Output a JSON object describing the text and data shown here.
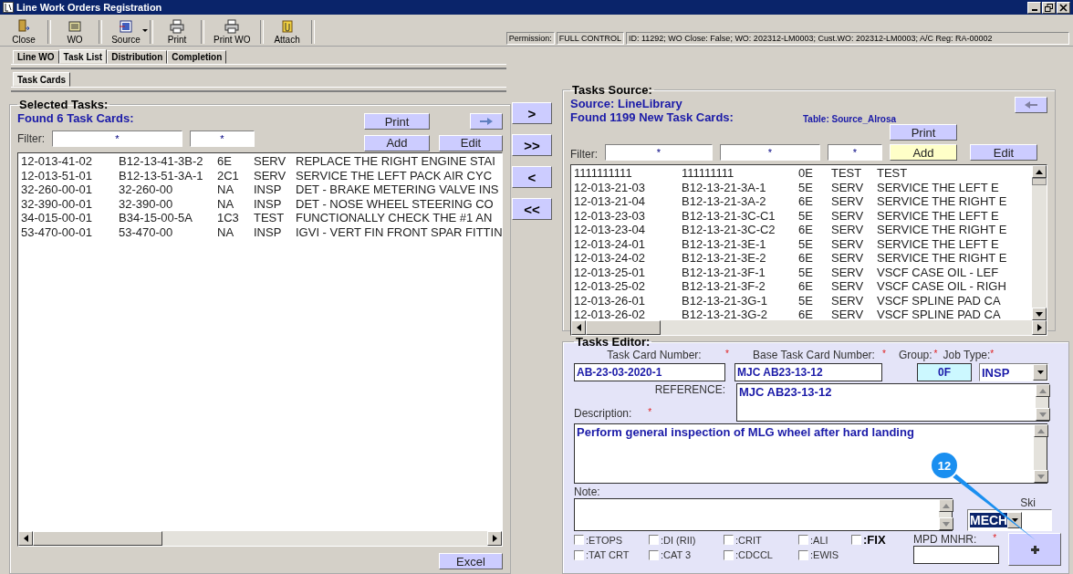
{
  "window": {
    "title": "Line Work Orders Registration"
  },
  "toolbar": [
    {
      "label": "Close",
      "kind": "door",
      "dropdown": false
    },
    {
      "label": "WO",
      "kind": "doc",
      "dropdown": false
    },
    {
      "label": "Source",
      "kind": "source",
      "dropdown": true
    },
    {
      "label": "Print",
      "kind": "printer",
      "dropdown": false
    },
    {
      "label": "Print WO",
      "kind": "printer",
      "dropdown": false
    },
    {
      "label": "Attach",
      "kind": "clip",
      "dropdown": false
    }
  ],
  "status": {
    "permission_label": "Permission:",
    "permission": "FULL CONTROL",
    "info": "ID: 11292; WO Close: False; WO: 202312-LM0003; Cust.WO: 202312-LM0003; A/C Reg: RA-00002"
  },
  "tabs": [
    {
      "label": "Line WO",
      "selected": false
    },
    {
      "label": "Task List",
      "selected": true
    },
    {
      "label": "Distribution",
      "selected": false
    },
    {
      "label": "Completion",
      "selected": false
    }
  ],
  "subtabs": [
    {
      "label": "Task Cards",
      "selected": true
    }
  ],
  "selected_tasks": {
    "title": "Selected Tasks:",
    "found": "Found 6 Task Cards:",
    "filter_label": "Filter:",
    "filters": [
      "*",
      "*"
    ],
    "buttons": [
      {
        "label": "Print",
        "highlighted": false
      },
      {
        "label": "Add",
        "highlighted": false
      },
      {
        "label": "Edit",
        "highlighted": false
      }
    ],
    "rows": [
      [
        "12-013-41-02",
        "B12-13-41-3B-2",
        "6E",
        "SERV",
        "REPLACE THE RIGHT ENGINE STAI"
      ],
      [
        "12-013-51-01",
        "B12-13-51-3A-1",
        "2C1",
        "SERV",
        "SERVICE THE LEFT PACK AIR CYC"
      ],
      [
        "32-260-00-01",
        "32-260-00",
        "NA",
        "INSP",
        "DET - BRAKE METERING VALVE INS"
      ],
      [
        "32-390-00-01",
        "32-390-00",
        "NA",
        "INSP",
        "DET - NOSE WHEEL STEERING CO"
      ],
      [
        "34-015-00-01",
        "B34-15-00-5A",
        "1C3",
        "TEST",
        "FUNCTIONALLY CHECK THE  #1 AN"
      ],
      [
        "53-470-00-01",
        "53-470-00",
        "NA",
        "INSP",
        "IGVI - VERT FIN FRONT SPAR FITTIN"
      ]
    ],
    "excel": "Excel"
  },
  "move_buttons": [
    ">",
    ">>",
    "<",
    "<<"
  ],
  "tasks_source": {
    "title": "Tasks Source:",
    "source": "Source: LineLibrary",
    "found": "Found 1199 New Task Cards:",
    "table": "Table: Source_Alrosa",
    "filter_label": "Filter:",
    "filters": [
      "*",
      "*",
      "*"
    ],
    "buttons": [
      {
        "label": "Print",
        "highlighted": false
      },
      {
        "label": "Add",
        "highlighted": true
      },
      {
        "label": "Edit",
        "highlighted": false
      }
    ],
    "rows": [
      [
        "1111111111",
        "111111111",
        "0E",
        "TEST",
        "TEST"
      ],
      [
        "12-013-21-03",
        "B12-13-21-3A-1",
        "5E",
        "SERV",
        "SERVICE THE LEFT E"
      ],
      [
        "12-013-21-04",
        "B12-13-21-3A-2",
        "6E",
        "SERV",
        "SERVICE THE RIGHT E"
      ],
      [
        "12-013-23-03",
        "B12-13-21-3C-C1",
        "5E",
        "SERV",
        "SERVICE THE LEFT E"
      ],
      [
        "12-013-23-04",
        "B12-13-21-3C-C2",
        "6E",
        "SERV",
        "SERVICE THE RIGHT E"
      ],
      [
        "12-013-24-01",
        "B12-13-21-3E-1",
        "5E",
        "SERV",
        "SERVICE THE LEFT E"
      ],
      [
        "12-013-24-02",
        "B12-13-21-3E-2",
        "6E",
        "SERV",
        "SERVICE THE RIGHT E"
      ],
      [
        "12-013-25-01",
        "B12-13-21-3F-1",
        "5E",
        "SERV",
        "VSCF CASE OIL - LEF"
      ],
      [
        "12-013-25-02",
        "B12-13-21-3F-2",
        "6E",
        "SERV",
        "VSCF CASE OIL - RIGH"
      ],
      [
        "12-013-26-01",
        "B12-13-21-3G-1",
        "5E",
        "SERV",
        "VSCF SPLINE PAD CA"
      ],
      [
        "12-013-26-02",
        "B12-13-21-3G-2",
        "6E",
        "SERV",
        "VSCF SPLINE PAD CA"
      ]
    ]
  },
  "editor": {
    "title": "Tasks Editor:",
    "task_card_number": {
      "label": "Task Card Number:",
      "mark": "*",
      "value": "AB-23-03-2020-1"
    },
    "base_task_card_number": {
      "label": "Base Task Card Number:",
      "mark": "*",
      "value": "MJC AB23-13-12"
    },
    "group": {
      "label": "Group:",
      "mark": "*",
      "value": "0F"
    },
    "job_type": {
      "label": "Job Type:",
      "mark": "*",
      "value": "INSP"
    },
    "reference": {
      "label": "REFERENCE:",
      "value": "MJC AB23-13-12"
    },
    "description": {
      "label": "Description:",
      "mark": "*",
      "value": "Perform general inspection of MLG wheel after hard landing"
    },
    "note": {
      "label": "Note:"
    },
    "skill": {
      "label": "Ski",
      "value": "MECH",
      "highlighted": true
    },
    "checkboxes": [
      {
        "label": ":ETOPS",
        "checked": false,
        "emphasis": false
      },
      {
        "label": ":DI (RII)",
        "checked": false,
        "emphasis": false
      },
      {
        "label": ":CRIT",
        "checked": false,
        "emphasis": false
      },
      {
        "label": ":ALI",
        "checked": false,
        "emphasis": false
      },
      {
        "label": ":FIX",
        "checked": false,
        "emphasis": true
      },
      {
        "label": ":TAT CRT",
        "checked": false,
        "emphasis": false
      },
      {
        "label": ":CAT 3",
        "checked": false,
        "emphasis": false
      },
      {
        "label": ":CDCCL",
        "checked": false,
        "emphasis": false
      },
      {
        "label": ":EWIS",
        "checked": false,
        "emphasis": false
      }
    ],
    "mpd_mnhr": {
      "label": "MPD MNHR:",
      "mark": "*"
    }
  },
  "callout": {
    "number": "12"
  }
}
